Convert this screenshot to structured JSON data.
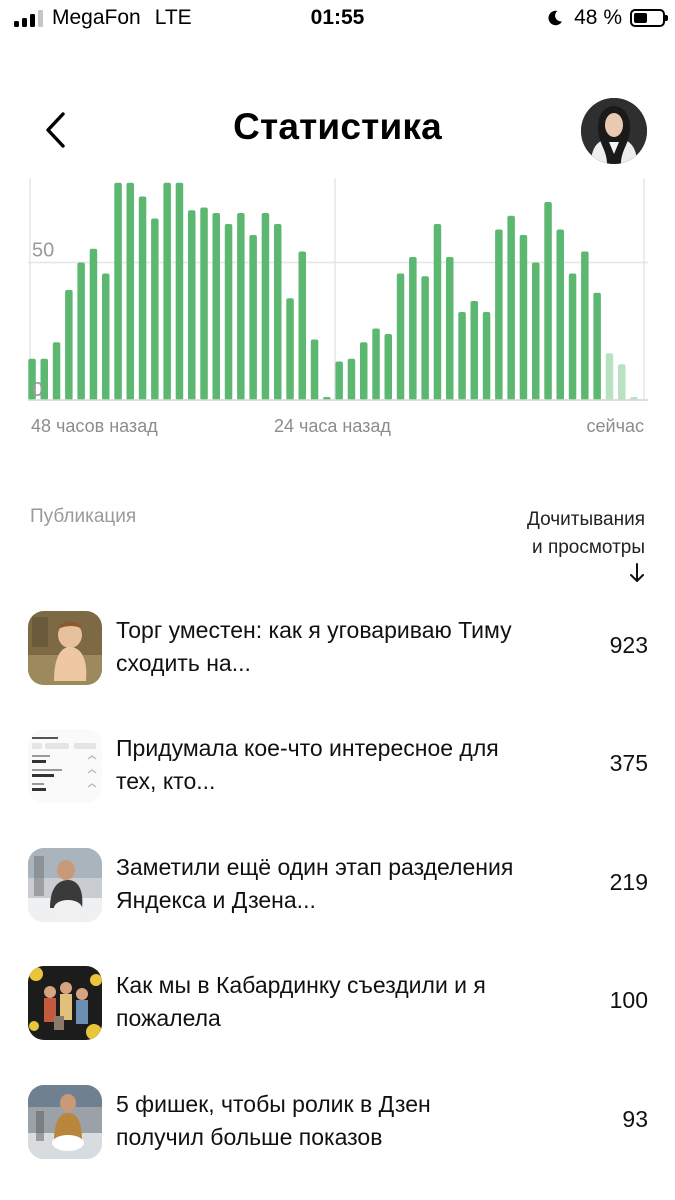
{
  "status_bar": {
    "carrier": "MegaFon",
    "network": "LTE",
    "time": "01:55",
    "battery_percent": "48 %",
    "battery_level": 0.48
  },
  "header": {
    "title": "Статистика",
    "back_icon": "chevron-left-icon",
    "avatar": "user-avatar"
  },
  "chart_data": {
    "type": "bar",
    "title": "",
    "y_ticks": [
      "50",
      "0"
    ],
    "y_tick_values": [
      50,
      0
    ],
    "ylim": [
      0,
      80
    ],
    "x_labels": [
      "48 часов назад",
      "24 часа назад",
      "сейчас"
    ],
    "grid": true,
    "series": [
      {
        "values": [
          15,
          15,
          21,
          40,
          50,
          55,
          46,
          79,
          79,
          74,
          66,
          79,
          79,
          69,
          70,
          68,
          64,
          68,
          60,
          68,
          64,
          37,
          54,
          22,
          0,
          14,
          15,
          21,
          26,
          24,
          46,
          52,
          45,
          64,
          52,
          32,
          36,
          32,
          62,
          67,
          60,
          50,
          72,
          62,
          46,
          54,
          39
        ]
      },
      {
        "values": [
          17,
          13,
          1
        ]
      }
    ],
    "colors": {
      "bars": "#5cb870",
      "bars_faded": "#b9e2c2",
      "grid": "#e6e6e6"
    }
  },
  "table": {
    "col_publication": "Публикация",
    "col_views_line1": "Дочитывания",
    "col_views_line2": "и просмотры",
    "sort_icon": "arrow-down-icon",
    "rows": [
      {
        "title": "Торг уместен: как я уговариваю Тиму сходить на...",
        "count": "923"
      },
      {
        "title": "Придумала кое-что интересное для тех, кто...",
        "count": "375"
      },
      {
        "title": "Заметили ещё один этап разделения Яндекса и Дзена...",
        "count": "219"
      },
      {
        "title": "Как мы в Кабардинку съездили и я пожалела",
        "count": "100"
      },
      {
        "title": "5 фишек, чтобы ролик в Дзен получил больше показов",
        "count": "93"
      }
    ]
  }
}
